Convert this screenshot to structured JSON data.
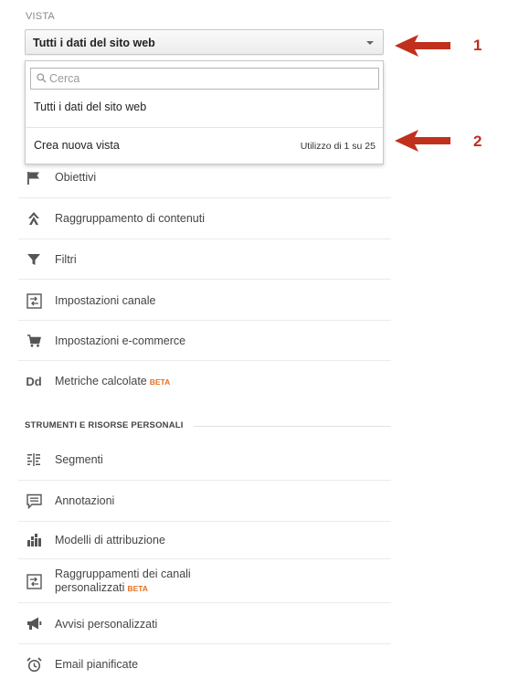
{
  "section_vista": {
    "label": "VISTA"
  },
  "view_select": {
    "value": "Tutti i dati del sito web"
  },
  "dropdown": {
    "search_placeholder": "Cerca",
    "option": "Tutti i dati del sito web",
    "create_label": "Crea nuova vista",
    "usage": "Utilizzo di 1 su 25"
  },
  "menu_top": [
    {
      "label": "Obiettivi",
      "icon": "flag-icon"
    },
    {
      "label": "Raggruppamento di contenuti",
      "icon": "content-grouping-icon"
    },
    {
      "label": "Filtri",
      "icon": "filter-icon"
    },
    {
      "label": "Impostazioni canale",
      "icon": "channel-settings-icon"
    },
    {
      "label": "Impostazioni e-commerce",
      "icon": "cart-icon"
    },
    {
      "label": "Metriche calcolate",
      "badge": "BETA",
      "icon": "dd-icon",
      "icon_text": "Dd"
    }
  ],
  "section_tools": {
    "title": "STRUMENTI E RISORSE PERSONALI"
  },
  "menu_tools": [
    {
      "label": "Segmenti",
      "icon": "segments-icon"
    },
    {
      "label": "Annotazioni",
      "icon": "annotation-icon"
    },
    {
      "label": "Modelli di attribuzione",
      "icon": "bar-chart-icon"
    },
    {
      "label_line1": "Raggruppamenti dei canali",
      "label_line2": "personalizzati",
      "badge": "BETA",
      "icon": "channel-groupings-icon"
    },
    {
      "label": "Avvisi personalizzati",
      "icon": "megaphone-icon"
    },
    {
      "label": "Email pianificate",
      "icon": "alarm-clock-icon"
    }
  ],
  "callouts": [
    {
      "number": "1"
    },
    {
      "number": "2"
    }
  ],
  "colors": {
    "arrow": "#c0301d",
    "beta": "#e3711f",
    "icon": "#555555"
  }
}
